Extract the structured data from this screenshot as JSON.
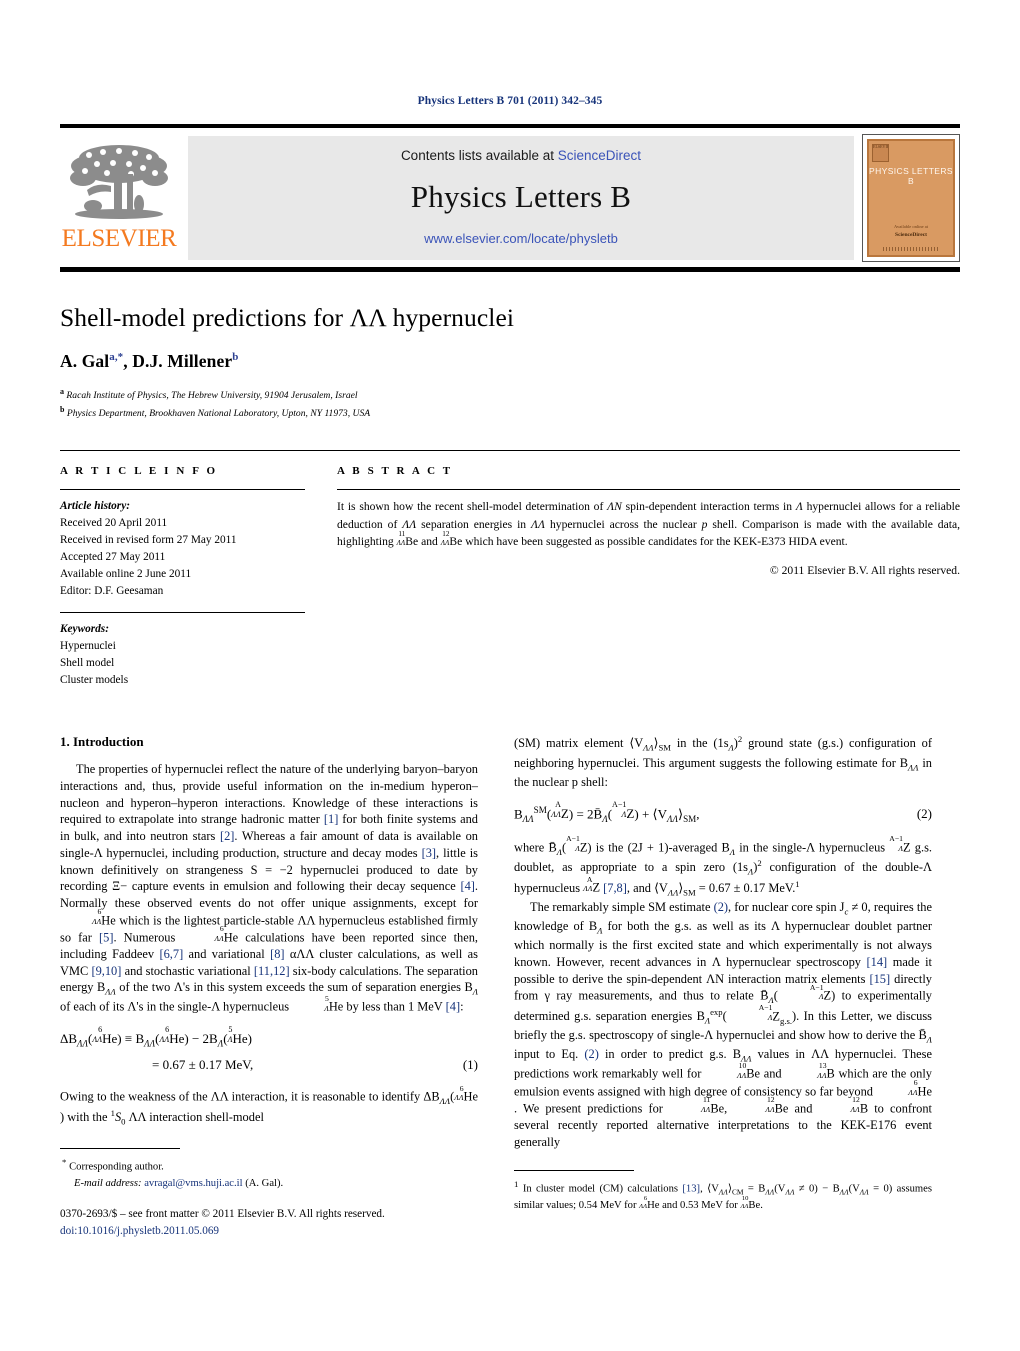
{
  "running_head": "Physics Letters B 701 (2011) 342–345",
  "masthead": {
    "contents_prefix": "Contents lists available at ",
    "sciencedirect": "ScienceDirect",
    "journal_title": "Physics Letters B",
    "journal_url": "www.elsevier.com/locate/physletb",
    "publisher_name": "ELSEVIER",
    "cover_title": "PHYSICS LETTERS B",
    "cover_badge": "ELSEVIER",
    "cover_editor_label": "Available online at",
    "cover_editor": "ScienceDirect",
    "accent_orange": "#f47a20",
    "link_blue": "#3a53b8"
  },
  "article": {
    "title": "Shell-model predictions for ΛΛ hypernuclei",
    "authors": "A. Gal",
    "author_a_sup": "a,*",
    "author_2": ", D.J. Millener",
    "author_b_sup": "b",
    "affiliation_a_sup": "a",
    "affiliation_a": "Racah Institute of Physics, The Hebrew University, 91904 Jerusalem, Israel",
    "affiliation_b_sup": "b",
    "affiliation_b": "Physics Department, Brookhaven National Laboratory, Upton, NY 11973, USA"
  },
  "info": {
    "heading": "A R T I C L E    I N F O",
    "history_label": "Article history:",
    "history": [
      "Received 20 April 2011",
      "Received in revised form 27 May 2011",
      "Accepted 27 May 2011",
      "Available online 2 June 2011",
      "Editor: D.F. Geesaman"
    ],
    "keywords_label": "Keywords:",
    "keywords": [
      "Hypernuclei",
      "Shell model",
      "Cluster models"
    ]
  },
  "abstract": {
    "heading": "A B S T R A C T",
    "part1": "It is shown how the recent shell-model determination of ",
    "an_symbol": "ΛN",
    "part2": " spin-dependent interaction terms in ",
    "lambda1": "Λ",
    "part3": " hypernuclei allows for a reliable deduction of ",
    "ll1": "ΛΛ",
    "part4": " separation energies in ",
    "ll2": "ΛΛ",
    "part5": " hypernuclei across the nuclear ",
    "p_italic": "p",
    "part6": " shell. Comparison is made with the available data, highlighting ",
    "nuc1_sup": "11",
    "nuc1_sub": "ΛΛ",
    "nuc1_el": "Be",
    "part7": " and ",
    "nuc2_sup": "12",
    "nuc2_sub": "ΛΛ",
    "nuc2_el": "Be",
    "part8": " which have been suggested as possible candidates for the KEK-E373 HIDA event.",
    "copyright": "© 2011 Elsevier B.V. All rights reserved."
  },
  "body": {
    "section1_title": "1. Introduction",
    "left": {
      "p1_a": "The properties of hypernuclei reflect the nature of the underlying baryon–baryon interactions and, thus, provide useful information on the in-medium hyperon–nucleon and hyperon–hyperon interactions. Knowledge of these interactions is required to extrapolate into strange hadronic matter ",
      "r1": "[1]",
      "p1_b": " for both finite systems and in bulk, and into neutron stars ",
      "r2": "[2]",
      "p1_c": ". Whereas a fair amount of data is available on single-Λ hypernuclei, including production, structure and decay modes ",
      "r3": "[3]",
      "p1_d": ", little is known definitively on strangeness S = −2 hypernuclei produced to date by recording Ξ− capture events in emulsion and following their decay sequence ",
      "r4": "[4]",
      "p1_e": ". Normally these observed events do not offer unique assignments, except for ",
      "nucHe_sup": "6",
      "nucHe_sub": "ΛΛ",
      "nucHe_el": "He",
      "p1_f": " which is the lightest particle-stable ΛΛ hypernucleus established firmly so far ",
      "r5": "[5]",
      "p1_g": ". Numerous ",
      "p1_h": " calculations have been reported since then, including Faddeev ",
      "r67": "[6,7]",
      "p1_i": " and variational ",
      "r8": "[8]",
      "p1_j": " αΛΛ cluster calculations, as well as VMC ",
      "r910": "[9,10]",
      "p1_k": " and stochastic variational ",
      "r1112": "[11,12]",
      "p1_l": " six-body calculations. The separation energy B",
      "p1_m": " of the two Λ's in this system exceeds the sum of separation energies B",
      "p1_n": " of each of its Λ's in the single-Λ hypernucleus ",
      "p1_o": " by less than 1 MeV ",
      "p1_p": ":",
      "eq1_line1": "ΔB",
      "eq1_num": "(1)",
      "eq1_value": "= 0.67 ± 0.17 MeV,",
      "p2_a": "Owing to the weakness of the ΛΛ interaction, it is reasonable to identify ΔB",
      "p2_b": " with the ",
      "p2_c": " ΛΛ interaction shell-model"
    },
    "right": {
      "p3_a": "(SM) matrix element ⟨V",
      "p3_b": "⟩",
      "p3_c": " in the (1s",
      "p3_d": ")",
      "p3_e": " ground state (g.s.) configuration of neighboring hypernuclei. This argument suggests the following estimate for B",
      "p3_f": " in the nuclear p shell:",
      "eq2_num": "(2)",
      "p4_a": "where ",
      "p4_b": " is the (2J + 1)-averaged B",
      "p4_c": " in the single-Λ hypernucleus ",
      "p4_d": " g.s. doublet, as appropriate to a spin zero (1s",
      "p4_e": ")",
      "p4_f": " configuration of the double-Λ hypernucleus ",
      "r78": "[7,8]",
      "p4_g": ", and ⟨V",
      "p4_h": "⟩",
      "p4_i": " = 0.67 ± 0.17 MeV.",
      "p5_a": "The remarkably simple SM estimate ",
      "eqref2": "(2)",
      "p5_b": ", for nuclear core spin J",
      "p5_c": " ≠ 0, requires the knowledge of B",
      "p5_d": " for both the g.s. as well as its Λ hypernuclear doublet partner which normally is the first excited state and which experimentally is not always known. However, recent advances in Λ hypernuclear spectroscopy ",
      "r14": "[14]",
      "p5_e": " made it possible to derive the spin-dependent ΛN interaction matrix elements ",
      "r15": "[15]",
      "p5_f": " directly from γ ray measurements, and thus to relate ",
      "p5_g": " to experimentally determined g.s. separation energies B",
      "p5_h": ". In this Letter, we discuss briefly the g.s. spectroscopy of single-Λ hypernuclei and show how to derive the ",
      "p5_i": " input to Eq. ",
      "p5_j": " in order to predict g.s. B",
      "p5_k": " values in ΛΛ hypernuclei. These predictions work remarkably well for ",
      "p5_l": " and ",
      "p5_m": " which are the only emulsion events assigned with high degree of consistency so far beyond ",
      "p5_n": ". We present predictions for ",
      "p5_o": ", ",
      "p5_p": " and ",
      "p5_q": " to confront several recently reported alternative interpretations to the KEK-E176 event generally"
    }
  },
  "footnotes": {
    "corresponding_marker": "*",
    "corresponding": "Corresponding author.",
    "email_label": "E-mail address:",
    "email": "avragal@vms.huji.ac.il",
    "email_owner": "(A. Gal).",
    "front_matter": "0370-2693/$ – see front matter © 2011 Elsevier B.V. All rights reserved.",
    "doi": "doi:10.1016/j.physletb.2011.05.069",
    "fn1_marker": "1",
    "fn1_a": "In cluster model (CM) calculations ",
    "fn1_ref": "[13]",
    "fn1_b": ", ⟨V",
    "fn1_c": "⟩",
    "fn1_d": " = B",
    "fn1_e": "(V",
    "fn1_f": " ≠ 0) − B",
    "fn1_g": "(V",
    "fn1_h": " = 0) assumes similar values; 0.54 MeV for ",
    "fn1_i": " and 0.53 MeV for ",
    "fn1_j": "."
  }
}
